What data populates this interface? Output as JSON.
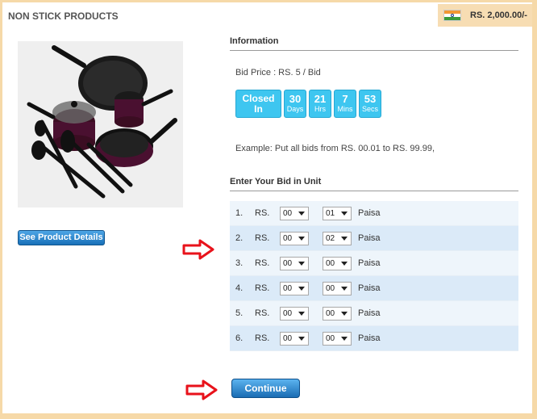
{
  "header": {
    "title": "NON STICK PRODUCTS",
    "balance": "RS. 2,000.00/-",
    "flag_icon": "india-flag-icon"
  },
  "product": {
    "image_icon": "cookware-set-image",
    "details_button": "See Product Details"
  },
  "information": {
    "heading": "Information",
    "bid_price": "Bid Price : RS. 5 / Bid",
    "timer": {
      "closed_label_line1": "Closed",
      "closed_label_line2": "In",
      "units": [
        {
          "value": "30",
          "label": "Days"
        },
        {
          "value": "21",
          "label": "Hrs"
        },
        {
          "value": "7",
          "label": "Mins"
        },
        {
          "value": "53",
          "label": "Secs"
        }
      ]
    },
    "example": "Example: Put all bids from RS. 00.01 to RS. 99.99,"
  },
  "bid_form": {
    "heading": "Enter Your Bid in Unit",
    "currency_label": "RS.",
    "paisa_label": "Paisa",
    "rows": [
      {
        "index": "1.",
        "rupees": "00",
        "paisa": "01"
      },
      {
        "index": "2.",
        "rupees": "00",
        "paisa": "02"
      },
      {
        "index": "3.",
        "rupees": "00",
        "paisa": "00"
      },
      {
        "index": "4.",
        "rupees": "00",
        "paisa": "00"
      },
      {
        "index": "5.",
        "rupees": "00",
        "paisa": "00"
      },
      {
        "index": "6.",
        "rupees": "00",
        "paisa": "00"
      }
    ],
    "continue_button": "Continue"
  },
  "colors": {
    "page_border": "#f6d9a8",
    "timer_tile": "#3ec6f0",
    "button_blue": "#1a6cb3",
    "annotation_arrow": "#e8121b"
  }
}
